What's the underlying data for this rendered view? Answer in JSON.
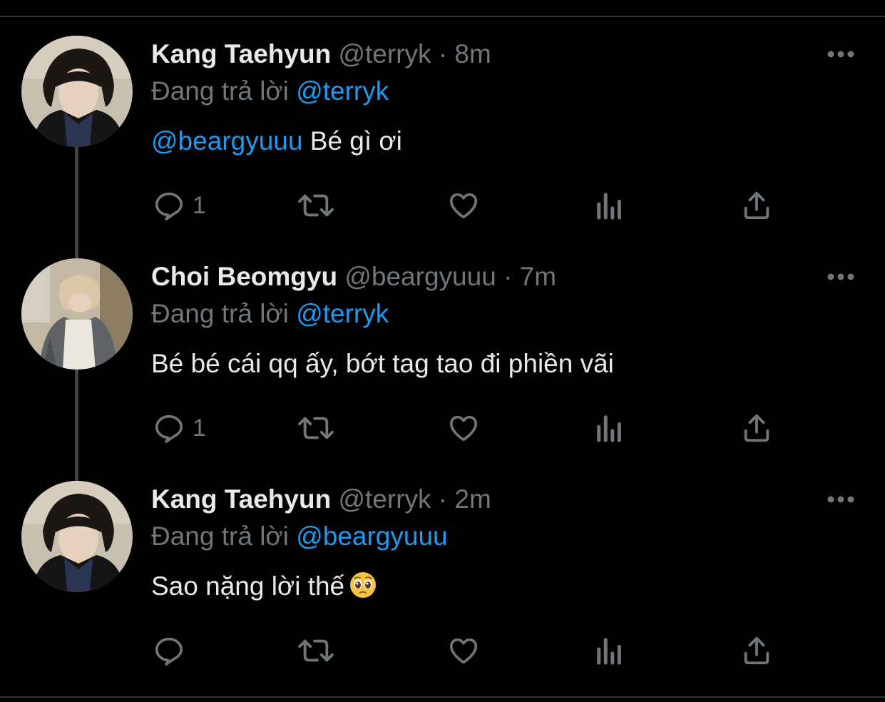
{
  "tweets": [
    {
      "display_name": "Kang Taehyun",
      "handle": "@terryk",
      "separator": "·",
      "time": "8m",
      "reply_prefix": "Đang trả lời",
      "reply_to": "@terryk",
      "mention": "@beargyuuu",
      "text": " Bé gì ơi",
      "reply_count": "1",
      "avatar": "avatar-taehyun"
    },
    {
      "display_name": "Choi Beomgyu",
      "handle": "@beargyuuu",
      "separator": "·",
      "time": "7m",
      "reply_prefix": "Đang trả lời",
      "reply_to": "@terryk",
      "mention": "",
      "text": "Bé bé cái qq ấy, bớt tag tao đi phiền vãi",
      "reply_count": "1",
      "avatar": "avatar-beomgyu"
    },
    {
      "display_name": "Kang Taehyun",
      "handle": "@terryk",
      "separator": "·",
      "time": "2m",
      "reply_prefix": "Đang trả lời",
      "reply_to": "@beargyuuu",
      "mention": "",
      "text": "Sao nặng lời thế",
      "emoji": "pleading-face-icon",
      "reply_count": "",
      "avatar": "avatar-taehyun"
    }
  ],
  "icons": [
    "more-icon",
    "reply-icon",
    "retweet-icon",
    "like-icon",
    "analytics-icon",
    "share-icon"
  ],
  "colors": {
    "background": "#000000",
    "text": "#e7e9ea",
    "secondary": "#71767b",
    "mention": "#1d9bf0",
    "thread_line": "#3e4144"
  }
}
